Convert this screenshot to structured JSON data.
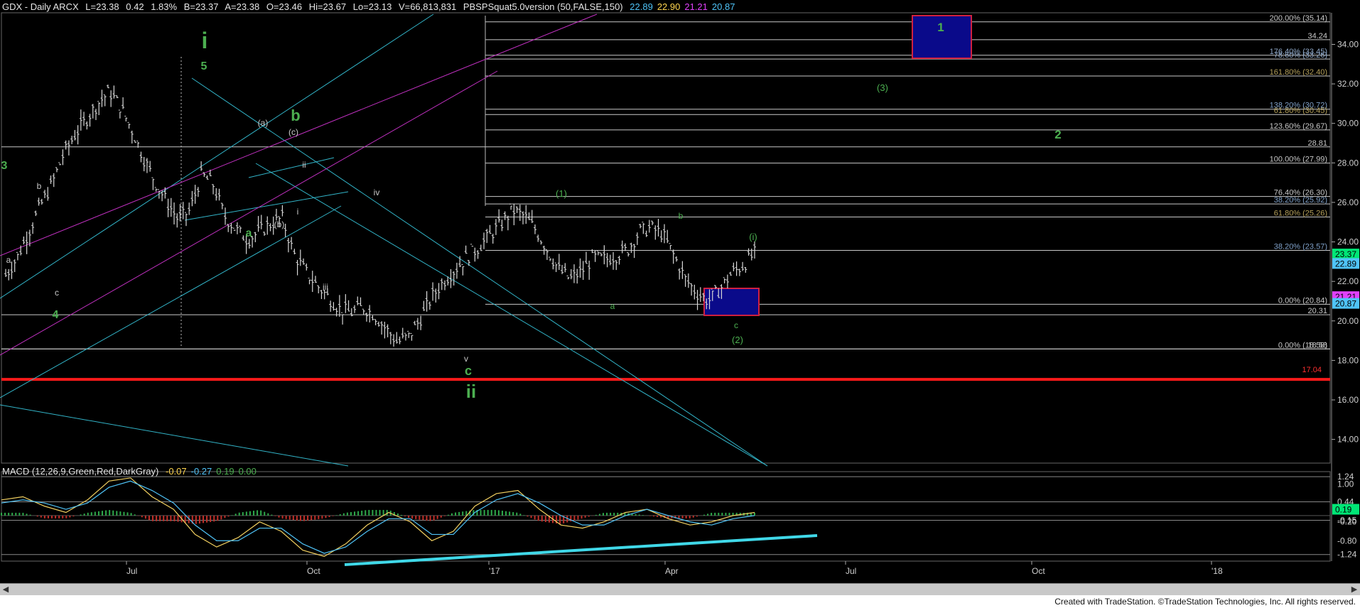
{
  "header": {
    "symbol": "GDX - Daily  ARCX",
    "last": "L=23.38",
    "change": "0.42",
    "change_pct": "1.83%",
    "bid": "B=23.37",
    "ask": "A=23.38",
    "open": "O=23.46",
    "hi": "Hi=23.67",
    "lo": "Lo=23.13",
    "volume": "V=66,813,831",
    "study": "PBSPSquat5.0version (50,FALSE,150)",
    "study_vals": [
      {
        "text": "22.89",
        "color": "#4fc3f7"
      },
      {
        "text": "22.90",
        "color": "#ffd54f"
      },
      {
        "text": "21.21",
        "color": "#e040fb"
      },
      {
        "text": "20.87",
        "color": "#4fc3f7"
      }
    ]
  },
  "macd_header": {
    "label": "MACD (12,26,9,Green,Red,DarkGray)",
    "vals": [
      {
        "text": "-0.07",
        "color": "#ffd54f"
      },
      {
        "text": "-0.27",
        "color": "#4fc3f7"
      },
      {
        "text": "0.19",
        "color": "#4caf50"
      },
      {
        "text": "0.00",
        "color": "#4caf50"
      }
    ]
  },
  "chart_data": [
    {
      "type": "candlestick",
      "title": "GDX - Daily",
      "x_ticks": [
        "Jul",
        "Oct",
        "'17",
        "Apr",
        "Jul",
        "Oct",
        "'18"
      ],
      "y_ticks": [
        "34.00",
        "32.00",
        "30.00",
        "28.00",
        "26.00",
        "24.00",
        "22.00",
        "20.00",
        "18.00",
        "16.00",
        "14.00"
      ],
      "ylim": [
        12.8,
        35.6
      ],
      "price_path": [
        22.3,
        23.2,
        24.5,
        25.8,
        26.9,
        28.4,
        29.4,
        30.2,
        31.0,
        31.6,
        30.8,
        29.6,
        28.2,
        27.0,
        26.0,
        25.1,
        25.6,
        27.4,
        26.9,
        25.3,
        24.6,
        24.1,
        24.5,
        24.9,
        25.2,
        23.4,
        22.5,
        21.8,
        21.2,
        20.6,
        20.4,
        20.7,
        20.3,
        19.6,
        18.9,
        19.2,
        20.1,
        21.2,
        22.0,
        22.6,
        23.2,
        23.7,
        24.3,
        24.9,
        25.6,
        25.3,
        24.6,
        23.6,
        22.6,
        22.1,
        22.5,
        23.2,
        23.1,
        23.3,
        23.6,
        24.5,
        24.7,
        24.4,
        23.3,
        22.1,
        21.4,
        21.0,
        21.6,
        22.4,
        22.8,
        23.4
      ],
      "right_axis_tags": [
        {
          "text": "23.37",
          "bg": "#00e676",
          "color": "#000",
          "value": 23.37
        },
        {
          "text": "22.89",
          "bg": "#4fc3f7",
          "color": "#000",
          "value": 22.89
        },
        {
          "text": "21.21",
          "bg": "#e040fb",
          "color": "#000",
          "value": 21.21
        },
        {
          "text": "20.87",
          "bg": "#4fc3f7",
          "color": "#000",
          "value": 20.87
        }
      ],
      "fib_levels": [
        {
          "text": "200.00% (35.14)",
          "value": 35.14,
          "color": "#c8c8c8"
        },
        {
          "text": "34.24",
          "value": 34.24,
          "color": "#c8c8c8"
        },
        {
          "text": "176.40% (33.45)",
          "value": 33.45,
          "color": "#8fa8c8"
        },
        {
          "text": "78.60% (33.26)",
          "value": 33.26,
          "color": "#8fa8c8"
        },
        {
          "text": "161.80% (32.40)",
          "value": 32.4,
          "color": "#b5a05a"
        },
        {
          "text": "138.20% (30.72)",
          "value": 30.72,
          "color": "#7fa0c8"
        },
        {
          "text": "61.80% (30.45)",
          "value": 30.45,
          "color": "#b5a05a"
        },
        {
          "text": "123.60% (29.67)",
          "value": 29.67,
          "color": "#c8c8c8"
        },
        {
          "text": "28.81",
          "value": 28.81,
          "color": "#c8c8c8"
        },
        {
          "text": "100.00% (27.99)",
          "value": 27.99,
          "color": "#c8c8c8"
        },
        {
          "text": "76.40% (26.30)",
          "value": 26.3,
          "color": "#c8c8c8"
        },
        {
          "text": "38.20% (25.92)",
          "value": 25.92,
          "color": "#7fa0c8"
        },
        {
          "text": "61.80% (25.26)",
          "value": 25.26,
          "color": "#b5a05a"
        },
        {
          "text": "38.20% (23.57)",
          "value": 23.57,
          "color": "#7fa0c8"
        },
        {
          "text": "0.00% (20.84)",
          "value": 20.84,
          "color": "#c8c8c8"
        },
        {
          "text": "20.31",
          "value": 20.31,
          "color": "#c8c8c8"
        },
        {
          "text": "18.58",
          "value": 18.58,
          "color": "#c8c8c8"
        },
        {
          "text": "0.00% (18.58)",
          "value": 18.58,
          "color": "#c8c8c8"
        },
        {
          "text": "17.04",
          "value": 17.04,
          "color": "#ff3030"
        }
      ],
      "wave_labels": [
        {
          "text": "i",
          "color": "#4caf50",
          "size": "big"
        },
        {
          "text": "5",
          "color": "#4caf50",
          "size": "mid"
        },
        {
          "text": "3",
          "color": "#4caf50",
          "size": "mid"
        },
        {
          "text": "4",
          "color": "#4caf50",
          "size": "mid"
        },
        {
          "text": "b",
          "color": "#4caf50",
          "size": "big"
        },
        {
          "text": "a",
          "color": "#4caf50",
          "size": "mid"
        },
        {
          "text": "c",
          "color": "#4caf50",
          "size": "mid"
        },
        {
          "text": "ii",
          "color": "#4caf50",
          "size": "big"
        },
        {
          "text": "(1)",
          "color": "#4caf50",
          "size": "small"
        },
        {
          "text": "(2)",
          "color": "#4caf50",
          "size": "small"
        },
        {
          "text": "(3)",
          "color": "#4caf50",
          "size": "small"
        },
        {
          "text": "2",
          "color": "#4caf50",
          "size": "mid"
        },
        {
          "text": "1",
          "color": "#4caf50",
          "size": "mid"
        },
        {
          "text": "(i)",
          "color": "#4caf50",
          "size": "small"
        },
        {
          "text": "b",
          "color": "#c8c8c8",
          "size": "small"
        },
        {
          "text": "a",
          "color": "#c8c8c8",
          "size": "small"
        },
        {
          "text": "c",
          "color": "#c8c8c8",
          "size": "small"
        },
        {
          "text": "(a)",
          "color": "#c8c8c8",
          "size": "small"
        },
        {
          "text": "(b)",
          "color": "#c8c8c8",
          "size": "small"
        },
        {
          "text": "(c)",
          "color": "#c8c8c8",
          "size": "small"
        },
        {
          "text": "i",
          "color": "#c8c8c8",
          "size": "small"
        },
        {
          "text": "ii",
          "color": "#c8c8c8",
          "size": "small"
        },
        {
          "text": "iii",
          "color": "#c8c8c8",
          "size": "small"
        },
        {
          "text": "iv",
          "color": "#c8c8c8",
          "size": "small"
        },
        {
          "text": "v",
          "color": "#c8c8c8",
          "size": "small"
        },
        {
          "text": "b",
          "color": "#4caf50",
          "size": "small"
        },
        {
          "text": "a",
          "color": "#4caf50",
          "size": "small"
        },
        {
          "text": "c",
          "color": "#4caf50",
          "size": "small"
        }
      ],
      "support_line_value": 17.04
    },
    {
      "type": "macd",
      "title": "MACD (12,26,9,Green,Red,DarkGray)",
      "y_ticks": [
        "1.24",
        "1.00",
        "0.44",
        "-0.15",
        "-0.20",
        "-0.80",
        "-1.24"
      ],
      "ylim": [
        -1.45,
        1.4
      ],
      "right_axis_tags": [
        {
          "text": "0.19",
          "bg": "#00e676",
          "color": "#000"
        },
        {
          "text": "-0.20",
          "bg": "#000",
          "color": "#ddd"
        }
      ],
      "macd_line": [
        0.5,
        0.6,
        0.3,
        0.1,
        0.5,
        1.1,
        1.2,
        0.6,
        0.2,
        -0.6,
        -1.0,
        -0.7,
        -0.2,
        -0.5,
        -1.1,
        -1.3,
        -0.9,
        -0.3,
        0.1,
        -0.2,
        -0.8,
        -0.5,
        0.3,
        0.7,
        0.8,
        0.2,
        -0.3,
        -0.4,
        -0.2,
        0.1,
        0.2,
        -0.1,
        -0.3,
        -0.2,
        0.0,
        0.1
      ],
      "signal_line": [
        0.4,
        0.5,
        0.4,
        0.2,
        0.4,
        0.9,
        1.1,
        0.8,
        0.4,
        -0.3,
        -0.8,
        -0.8,
        -0.4,
        -0.4,
        -0.9,
        -1.2,
        -1.0,
        -0.5,
        -0.1,
        -0.1,
        -0.6,
        -0.6,
        0.1,
        0.5,
        0.7,
        0.4,
        0.0,
        -0.3,
        -0.3,
        0.0,
        0.2,
        0.0,
        -0.2,
        -0.3,
        -0.1,
        0.0
      ]
    }
  ],
  "footer": "Created with TradeStation. ©TradeStation Technologies, Inc. All rights reserved."
}
